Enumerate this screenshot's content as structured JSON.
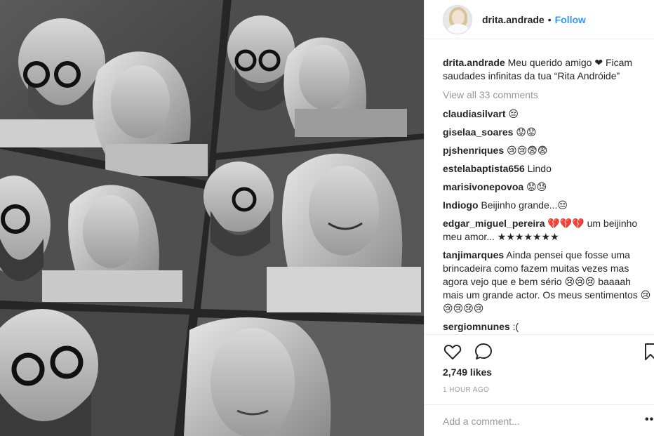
{
  "post": {
    "username": "drita.andrade",
    "separator": "•",
    "follow_label": "Follow"
  },
  "caption": {
    "user": "drita.andrade",
    "text": "Meu querido amigo ❤ Ficam saudades infinitas da tua “Rita Andróide”"
  },
  "view_all_label": "View all 33 comments",
  "comments": [
    {
      "user": "claudiasilvart",
      "text": "😔"
    },
    {
      "user": "giselaa_soares",
      "text": "😟😟"
    },
    {
      "user": "pjshenriques",
      "text": "😢😢😨😨"
    },
    {
      "user": "estelabaptista656",
      "text": "Lindo"
    },
    {
      "user": "marisivonepovoa",
      "text": "😟😓"
    },
    {
      "user": "Indiogo",
      "text": "Beijinho grande...😔"
    },
    {
      "user": "edgar_miguel_pereira",
      "text": "💔💔💔 um beijinho meu amor... ★★★★★★★"
    },
    {
      "user": "tanjimarques",
      "text": "Ainda pensei que fosse uma brincadeira como fazem muitas vezes mas agora vejo que e bem sério 😢😢😢 baaaah mais um grande actor. Os meus sentimentos 😢😢😢😢😢"
    },
    {
      "user": "sergiomnunes",
      "text": ":("
    }
  ],
  "likes_label": "2,749 likes",
  "time_label": "1 HOUR AGO",
  "add_comment_placeholder": "Add a comment...",
  "more_label": "••",
  "icons": {
    "like": "heart-icon",
    "comment": "comment-bubble-icon",
    "save": "bookmark-icon"
  },
  "colors": {
    "link": "#3897f0",
    "muted": "#999999",
    "text": "#262626"
  }
}
